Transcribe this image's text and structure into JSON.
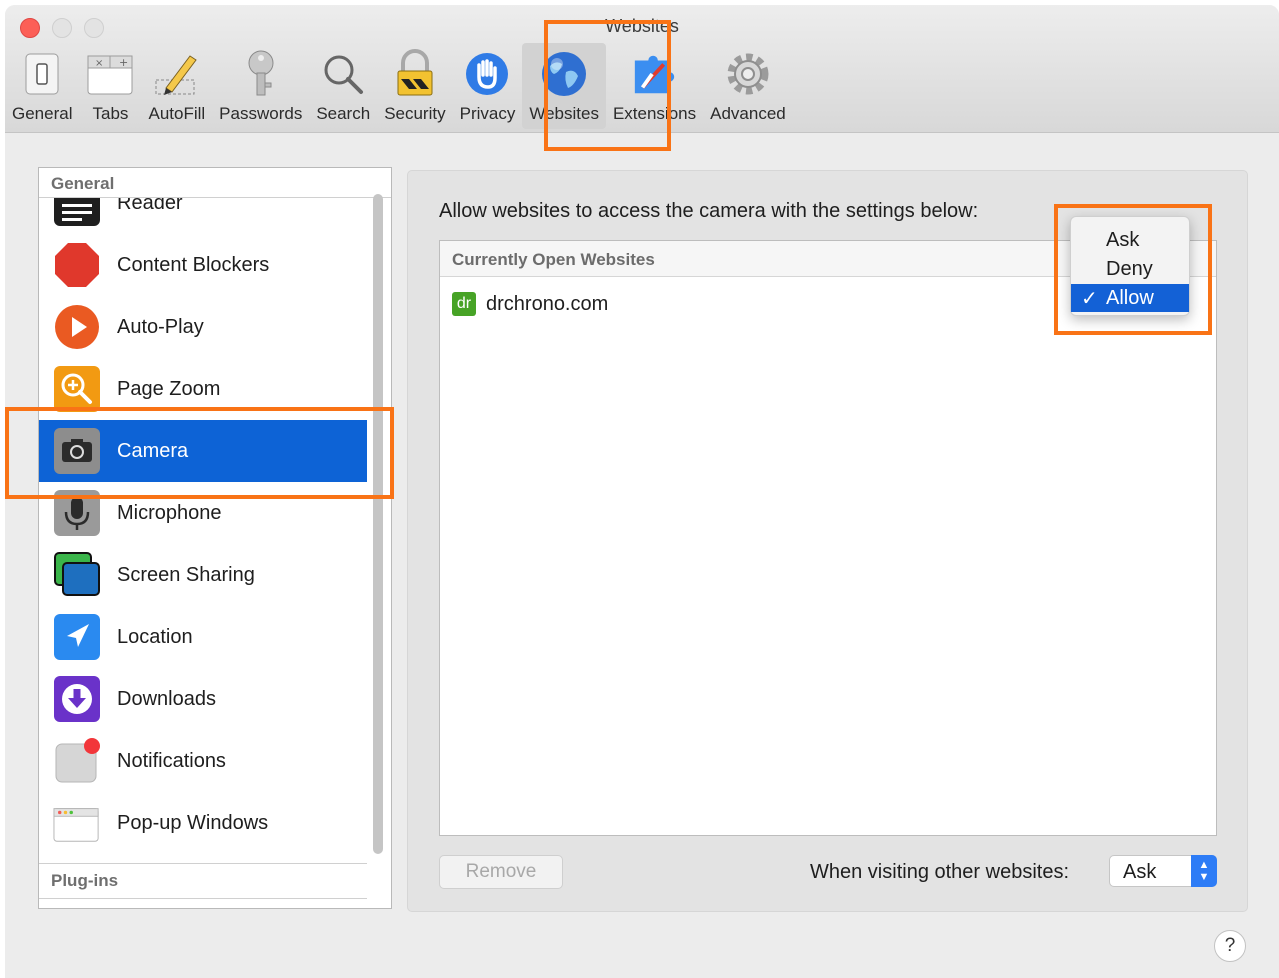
{
  "window": {
    "title": "Websites"
  },
  "toolbar": {
    "items": [
      {
        "label": "General",
        "icon": "switch-icon"
      },
      {
        "label": "Tabs",
        "icon": "tabs-icon"
      },
      {
        "label": "AutoFill",
        "icon": "pencil-icon"
      },
      {
        "label": "Passwords",
        "icon": "key-icon"
      },
      {
        "label": "Search",
        "icon": "magnifier-icon"
      },
      {
        "label": "Security",
        "icon": "lock-icon"
      },
      {
        "label": "Privacy",
        "icon": "hand-icon"
      },
      {
        "label": "Websites",
        "icon": "globe-icon",
        "selected": true
      },
      {
        "label": "Extensions",
        "icon": "puzzle-icon"
      },
      {
        "label": "Advanced",
        "icon": "gear-icon"
      }
    ]
  },
  "sidebar": {
    "header": "General",
    "footer": "Plug-ins",
    "items": [
      {
        "label": "Reader",
        "icon": "reader-icon"
      },
      {
        "label": "Content Blockers",
        "icon": "stop-icon"
      },
      {
        "label": "Auto-Play",
        "icon": "play-icon"
      },
      {
        "label": "Page Zoom",
        "icon": "zoom-icon"
      },
      {
        "label": "Camera",
        "icon": "camera-icon",
        "selected": true
      },
      {
        "label": "Microphone",
        "icon": "microphone-icon"
      },
      {
        "label": "Screen Sharing",
        "icon": "screen-sharing-icon"
      },
      {
        "label": "Location",
        "icon": "location-arrow-icon"
      },
      {
        "label": "Downloads",
        "icon": "download-icon"
      },
      {
        "label": "Notifications",
        "icon": "notification-icon"
      },
      {
        "label": "Pop-up Windows",
        "icon": "popup-window-icon"
      }
    ]
  },
  "panel": {
    "description": "Allow websites to access the camera with the settings below:",
    "table_header": "Currently Open Websites",
    "websites": [
      {
        "favicon": "dr",
        "name": "drchrono.com",
        "setting": "Allow"
      }
    ],
    "remove_label": "Remove",
    "other_label": "When visiting other websites:",
    "other_value": "Ask"
  },
  "dropdown": {
    "options": [
      "Ask",
      "Deny",
      "Allow"
    ],
    "selected": "Allow",
    "check": "✓"
  },
  "help": "?",
  "colors": {
    "selection_blue": "#0d63d6",
    "highlight_orange": "#f97316",
    "favicon_green": "#47a326"
  }
}
